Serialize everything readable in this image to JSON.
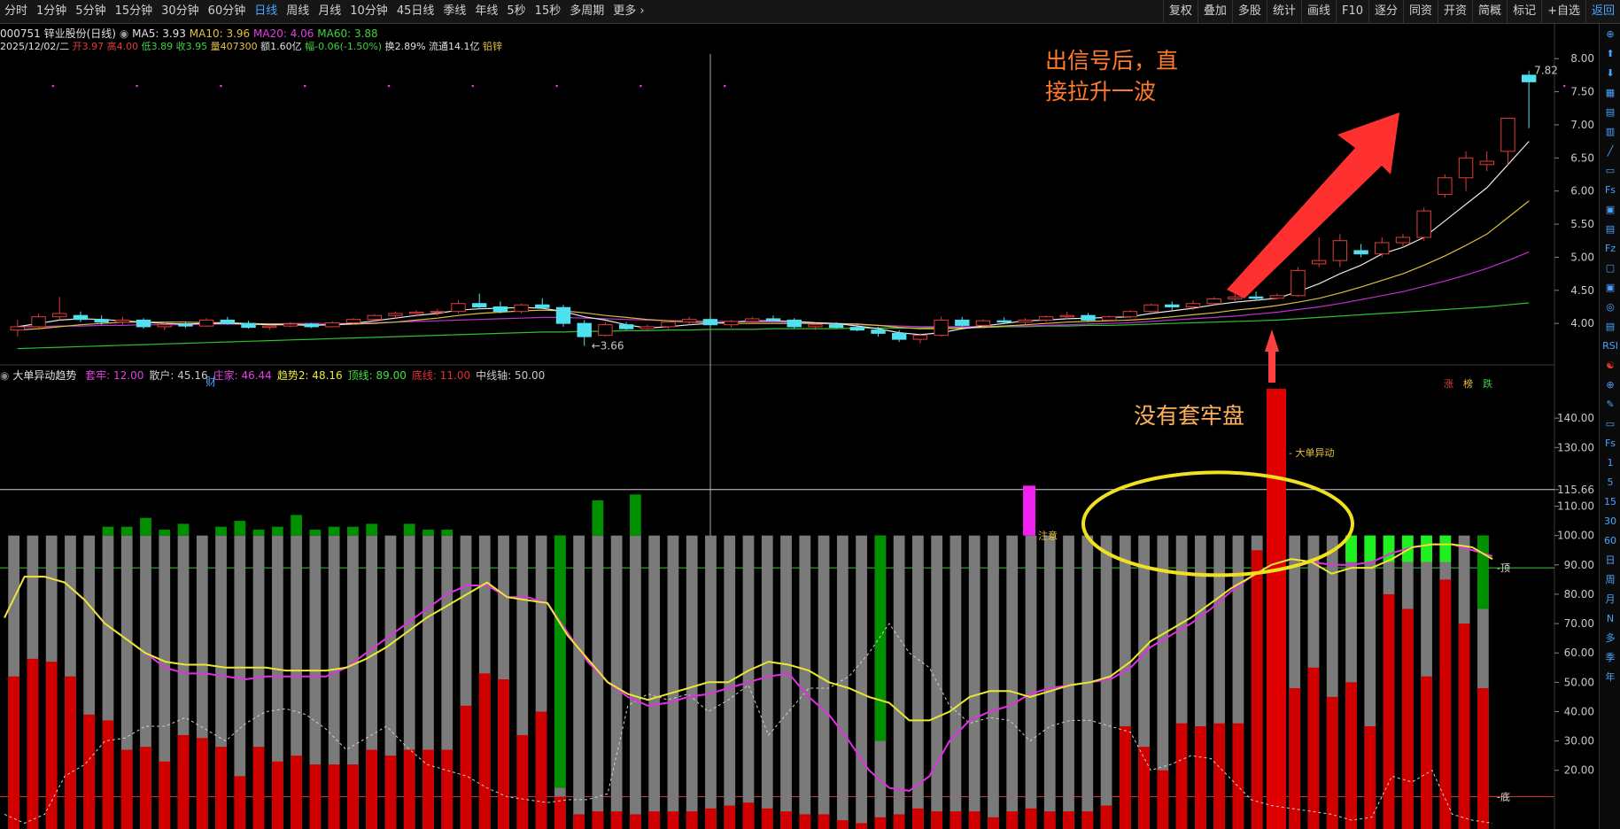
{
  "toolbar": {
    "left": [
      "分时",
      "1分钟",
      "5分钟",
      "15分钟",
      "30分钟",
      "60分钟",
      "日线",
      "周线",
      "月线",
      "10分钟",
      "45日线",
      "季线",
      "年线",
      "5秒",
      "15秒",
      "多周期",
      "更多 ›"
    ],
    "active_index": 6,
    "right": [
      "复权",
      "叠加",
      "多股",
      "统计",
      "画线",
      "F10",
      "逐分",
      "同资",
      "开资",
      "简概",
      "标记",
      "+自选",
      "返回"
    ],
    "right_highlight": [
      12
    ]
  },
  "header": {
    "code_name": "000751 锌业股份(日线)",
    "ma5": "MA5: 3.93",
    "ma10": "MA10: 3.96",
    "ma20": "MA20: 4.06",
    "ma60": "MA60: 3.88",
    "date": "2025/12/02/二",
    "open": "开3.97",
    "high": "高4.00",
    "low": "低3.89",
    "close": "收3.95",
    "vol": "量407300",
    "amount": "额1.60亿",
    "change": "幅-0.06(-1.50%)",
    "turnover": "换2.89%",
    "float": "流通14.1亿",
    "concept": "铅锌"
  },
  "annotations": {
    "top_line1": "出信号后，直",
    "top_line2": "接拉升一波",
    "bottom": "没有套牢盘"
  },
  "price_chart": {
    "y_ticks": [
      "8.00",
      "7.50",
      "7.00",
      "6.50",
      "6.00",
      "5.50",
      "5.00",
      "4.50",
      "4.00"
    ],
    "low_label": "3.66",
    "high_label": "7.82",
    "cai_label": "财",
    "bottom_tags": [
      "涨",
      "榜",
      "跌"
    ]
  },
  "indicator": {
    "title": "大单异动趋势",
    "vals": [
      {
        "label": "套牢: 12.00",
        "color": "#e040e0"
      },
      {
        "label": "散户: 45.16",
        "color": "#c8c8c8"
      },
      {
        "label": "庄家: 46.44",
        "color": "#e040e0"
      },
      {
        "label": "趋势2: 48.16",
        "color": "#e8e840"
      },
      {
        "label": "顶线: 89.00",
        "color": "#40e040"
      },
      {
        "label": "底线: 11.00",
        "color": "#e03030"
      },
      {
        "label": "中线轴: 50.00",
        "color": "#c8c8c8"
      }
    ],
    "y_ticks": [
      "140.00",
      "130.00",
      "115.66",
      "110.00",
      "100.00",
      "90.00",
      "80.00",
      "70.00",
      "60.00",
      "50.00",
      "40.00",
      "30.00",
      "20.00"
    ],
    "label_dadan": "大单异动",
    "label_zhuyi": "注意",
    "label_ding": "顶",
    "label_di": "底"
  },
  "sidebar": [
    "⊕",
    "⬆",
    "⬇",
    "▦",
    "▤",
    "▥",
    "╱",
    "▭",
    "Fs",
    "▣",
    "▤",
    "Fz",
    "▢",
    "▣",
    "◎",
    "▤",
    "RSI",
    "☯",
    "⊕",
    "✎",
    "▭",
    "Fs",
    "1",
    "5",
    "15",
    "30",
    "60",
    "日",
    "周",
    "月",
    "N",
    "多",
    "季",
    "年"
  ],
  "chart_data": {
    "type": "candlestick",
    "price": {
      "ylim": [
        3.4,
        8.15
      ],
      "candles_ohlc": [
        [
          3.9,
          4.05,
          3.8,
          3.95
        ],
        [
          3.95,
          4.15,
          3.9,
          4.1
        ],
        [
          4.1,
          4.4,
          4.05,
          4.15
        ],
        [
          4.12,
          4.18,
          4.02,
          4.06
        ],
        [
          4.06,
          4.12,
          3.98,
          4.02
        ],
        [
          4.02,
          4.1,
          3.98,
          4.05
        ],
        [
          4.05,
          4.08,
          3.92,
          3.95
        ],
        [
          3.95,
          4.02,
          3.9,
          3.98
        ],
        [
          3.98,
          4.03,
          3.93,
          3.96
        ],
        [
          3.96,
          4.08,
          3.95,
          4.05
        ],
        [
          4.05,
          4.1,
          3.98,
          4.0
        ],
        [
          4.0,
          4.04,
          3.92,
          3.94
        ],
        [
          3.94,
          3.98,
          3.9,
          3.96
        ],
        [
          3.96,
          4.02,
          3.94,
          3.99
        ],
        [
          3.99,
          4.01,
          3.93,
          3.95
        ],
        [
          3.95,
          4.03,
          3.94,
          4.01
        ],
        [
          4.01,
          4.08,
          3.99,
          4.06
        ],
        [
          4.06,
          4.14,
          4.04,
          4.12
        ],
        [
          4.12,
          4.18,
          4.08,
          4.15
        ],
        [
          4.15,
          4.2,
          4.1,
          4.17
        ],
        [
          4.17,
          4.22,
          4.12,
          4.18
        ],
        [
          4.18,
          4.35,
          4.15,
          4.3
        ],
        [
          4.3,
          4.45,
          4.22,
          4.25
        ],
        [
          4.25,
          4.33,
          4.15,
          4.18
        ],
        [
          4.18,
          4.3,
          4.15,
          4.28
        ],
        [
          4.28,
          4.38,
          4.22,
          4.24
        ],
        [
          4.24,
          4.28,
          3.95,
          4.0
        ],
        [
          4.0,
          4.05,
          3.66,
          3.8
        ],
        [
          3.82,
          4.02,
          3.8,
          3.98
        ],
        [
          3.98,
          4.02,
          3.9,
          3.92
        ],
        [
          3.92,
          3.98,
          3.88,
          3.95
        ],
        [
          3.95,
          4.05,
          3.92,
          4.02
        ],
        [
          4.02,
          4.1,
          3.98,
          4.06
        ],
        [
          4.06,
          4.1,
          3.95,
          3.98
        ],
        [
          3.98,
          4.05,
          3.94,
          4.03
        ],
        [
          4.03,
          4.1,
          4.0,
          4.07
        ],
        [
          4.07,
          4.12,
          4.03,
          4.05
        ],
        [
          4.05,
          4.08,
          3.92,
          3.95
        ],
        [
          3.95,
          4.0,
          3.9,
          3.98
        ],
        [
          3.98,
          4.02,
          3.92,
          3.94
        ],
        [
          3.94,
          3.98,
          3.88,
          3.9
        ],
        [
          3.9,
          3.95,
          3.8,
          3.85
        ],
        [
          3.85,
          3.9,
          3.72,
          3.76
        ],
        [
          3.76,
          3.85,
          3.7,
          3.82
        ],
        [
          3.82,
          4.1,
          3.8,
          4.05
        ],
        [
          4.05,
          4.1,
          3.95,
          3.97
        ],
        [
          3.97,
          4.06,
          3.95,
          4.04
        ],
        [
          4.04,
          4.09,
          4.0,
          4.02
        ],
        [
          4.02,
          4.08,
          3.98,
          4.05
        ],
        [
          4.05,
          4.12,
          4.02,
          4.1
        ],
        [
          4.1,
          4.18,
          4.06,
          4.12
        ],
        [
          4.12,
          4.16,
          4.02,
          4.05
        ],
        [
          4.05,
          4.12,
          4.03,
          4.1
        ],
        [
          4.1,
          4.2,
          4.08,
          4.18
        ],
        [
          4.18,
          4.3,
          4.15,
          4.28
        ],
        [
          4.28,
          4.33,
          4.2,
          4.25
        ],
        [
          4.25,
          4.35,
          4.2,
          4.3
        ],
        [
          4.3,
          4.4,
          4.28,
          4.37
        ],
        [
          4.37,
          4.45,
          4.32,
          4.4
        ],
        [
          4.4,
          4.48,
          4.36,
          4.38
        ],
        [
          4.38,
          4.45,
          4.36,
          4.42
        ],
        [
          4.42,
          4.85,
          4.4,
          4.8
        ],
        [
          4.9,
          5.3,
          4.85,
          4.95
        ],
        [
          4.95,
          5.35,
          4.85,
          5.25
        ],
        [
          5.1,
          5.2,
          5.0,
          5.05
        ],
        [
          5.05,
          5.3,
          5.0,
          5.22
        ],
        [
          5.22,
          5.35,
          5.15,
          5.3
        ],
        [
          5.3,
          5.75,
          5.25,
          5.7
        ],
        [
          5.95,
          6.25,
          5.9,
          6.2
        ],
        [
          6.2,
          6.6,
          6.0,
          6.5
        ],
        [
          6.4,
          6.6,
          6.3,
          6.45
        ],
        [
          6.6,
          7.1,
          6.4,
          7.1
        ],
        [
          7.75,
          7.82,
          6.95,
          7.65
        ]
      ],
      "ma5": [
        3.95,
        4.0,
        4.05,
        4.07,
        4.06,
        4.04,
        4.02,
        4.0,
        3.99,
        4.0,
        4.0,
        3.99,
        3.98,
        3.98,
        3.97,
        3.98,
        4.0,
        4.04,
        4.08,
        4.12,
        4.15,
        4.2,
        4.22,
        4.23,
        4.24,
        4.23,
        4.18,
        4.1,
        4.05,
        3.98,
        3.93,
        3.95,
        3.98,
        4.0,
        4.02,
        4.04,
        4.04,
        4.03,
        4.01,
        4.0,
        3.96,
        3.92,
        3.86,
        3.83,
        3.86,
        3.92,
        3.96,
        4.0,
        4.04,
        4.05,
        4.07,
        4.08,
        4.09,
        4.1,
        4.15,
        4.19,
        4.23,
        4.28,
        4.32,
        4.35,
        4.38,
        4.48,
        4.6,
        4.75,
        4.88,
        5.05,
        5.15,
        5.3,
        5.55,
        5.8,
        6.05,
        6.4,
        6.75
      ],
      "ma10": [
        3.9,
        3.92,
        3.95,
        3.98,
        4.0,
        4.02,
        4.02,
        4.02,
        4.02,
        4.01,
        4.01,
        4.0,
        3.99,
        3.99,
        3.98,
        3.98,
        3.99,
        4.0,
        4.02,
        4.05,
        4.08,
        4.12,
        4.15,
        4.17,
        4.19,
        4.2,
        4.19,
        4.16,
        4.12,
        4.09,
        4.06,
        4.04,
        4.02,
        4.01,
        4.0,
        4.0,
        4.0,
        4.0,
        4.0,
        4.0,
        3.99,
        3.97,
        3.94,
        3.92,
        3.92,
        3.93,
        3.94,
        3.96,
        3.98,
        4.0,
        4.02,
        4.03,
        4.04,
        4.05,
        4.07,
        4.1,
        4.13,
        4.16,
        4.2,
        4.23,
        4.27,
        4.32,
        4.38,
        4.46,
        4.55,
        4.65,
        4.75,
        4.88,
        5.02,
        5.18,
        5.35,
        5.6,
        5.85
      ],
      "ma20": [
        3.95,
        3.95,
        3.96,
        3.96,
        3.97,
        3.97,
        3.98,
        3.98,
        3.98,
        3.99,
        3.99,
        3.99,
        3.99,
        4.0,
        4.0,
        4.0,
        4.0,
        4.01,
        4.02,
        4.03,
        4.04,
        4.05,
        4.06,
        4.07,
        4.08,
        4.09,
        4.09,
        4.08,
        4.07,
        4.06,
        4.05,
        4.04,
        4.04,
        4.03,
        4.03,
        4.02,
        4.02,
        4.01,
        4.0,
        3.99,
        3.98,
        3.97,
        3.96,
        3.95,
        3.95,
        3.95,
        3.95,
        3.96,
        3.96,
        3.97,
        3.98,
        3.99,
        4.0,
        4.01,
        4.03,
        4.05,
        4.07,
        4.09,
        4.11,
        4.14,
        4.17,
        4.21,
        4.25,
        4.3,
        4.36,
        4.42,
        4.48,
        4.56,
        4.64,
        4.73,
        4.83,
        4.95,
        5.08
      ],
      "ma60": [
        3.62,
        3.63,
        3.64,
        3.65,
        3.66,
        3.67,
        3.68,
        3.69,
        3.7,
        3.71,
        3.72,
        3.73,
        3.74,
        3.75,
        3.76,
        3.77,
        3.78,
        3.79,
        3.8,
        3.81,
        3.82,
        3.83,
        3.84,
        3.85,
        3.86,
        3.87,
        3.87,
        3.88,
        3.88,
        3.89,
        3.89,
        3.9,
        3.9,
        3.91,
        3.91,
        3.91,
        3.92,
        3.92,
        3.92,
        3.92,
        3.93,
        3.93,
        3.93,
        3.93,
        3.94,
        3.94,
        3.94,
        3.95,
        3.95,
        3.96,
        3.96,
        3.97,
        3.97,
        3.98,
        3.99,
        4.0,
        4.01,
        4.02,
        4.03,
        4.04,
        4.05,
        4.07,
        4.09,
        4.11,
        4.13,
        4.15,
        4.17,
        4.19,
        4.21,
        4.23,
        4.25,
        4.28,
        4.31
      ]
    },
    "indicator": {
      "ylim": [
        0,
        150
      ],
      "top_line": 89,
      "bottom_line": 11,
      "total_bar": 100,
      "red_values": [
        52,
        58,
        57,
        52,
        39,
        37,
        27,
        28,
        23,
        32,
        31,
        28,
        18,
        28,
        23,
        25,
        22,
        22,
        22,
        27,
        25,
        27,
        27,
        27,
        42,
        53,
        51,
        32,
        40,
        11,
        5,
        6,
        6,
        5,
        6,
        6,
        6,
        7,
        8,
        9,
        7,
        6,
        5,
        5,
        3,
        2,
        4,
        5,
        7,
        6,
        6,
        6,
        4,
        6,
        7,
        6,
        6,
        6,
        8,
        35,
        28,
        20,
        36,
        35,
        36,
        36,
        95,
        72,
        48,
        55,
        45,
        50,
        35,
        80,
        75,
        52,
        85,
        70,
        48
      ],
      "green_values": [
        0,
        0,
        0,
        0,
        0,
        3,
        3,
        6,
        2,
        4,
        0,
        3,
        5,
        2,
        3,
        7,
        2,
        3,
        3,
        4,
        0,
        4,
        2,
        2,
        0,
        0,
        0,
        0,
        0,
        0,
        0,
        12,
        0,
        14,
        0,
        0,
        0,
        0,
        0,
        0,
        0,
        0,
        0,
        0,
        0,
        0,
        0,
        0,
        0,
        0,
        0,
        0,
        0,
        0,
        0,
        0,
        0,
        0,
        0,
        0,
        0,
        0,
        0,
        0,
        0,
        0,
        0,
        0,
        0,
        0,
        0,
        0,
        0,
        0,
        0,
        0,
        0,
        0,
        0
      ],
      "green_down_values": [
        0,
        0,
        0,
        0,
        0,
        0,
        0,
        0,
        0,
        0,
        0,
        0,
        0,
        0,
        0,
        0,
        0,
        0,
        0,
        0,
        0,
        0,
        0,
        0,
        0,
        0,
        0,
        0,
        0,
        86,
        0,
        0,
        0,
        0,
        0,
        0,
        0,
        0,
        0,
        0,
        0,
        0,
        0,
        0,
        0,
        0,
        70,
        0,
        0,
        0,
        0,
        0,
        0,
        0,
        0,
        0,
        0,
        0,
        0,
        0,
        0,
        0,
        0,
        0,
        0,
        0,
        0,
        0,
        0,
        0,
        0,
        0,
        0,
        0,
        0,
        0,
        0,
        0,
        25
      ],
      "trend_yellow": [
        72,
        86,
        86,
        84,
        78,
        70,
        65,
        60,
        57,
        56,
        56,
        55,
        55,
        55,
        54,
        54,
        54,
        55,
        58,
        62,
        67,
        72,
        76,
        80,
        84,
        79,
        78,
        77,
        66,
        58,
        50,
        46,
        44,
        46,
        48,
        50,
        50,
        54,
        57,
        56,
        54,
        50,
        48,
        45,
        43,
        37,
        37,
        40,
        45,
        47,
        47,
        45,
        47,
        49,
        50,
        52,
        57,
        64,
        68,
        72,
        77,
        82,
        86,
        90,
        92,
        91,
        87,
        89,
        89,
        92,
        96,
        97,
        97,
        96,
        92
      ],
      "zhuangjia_magenta": [
        72,
        86,
        86,
        84,
        78,
        70,
        65,
        60,
        55,
        53,
        53,
        52,
        51,
        52,
        52,
        52,
        52,
        55,
        60,
        65,
        70,
        75,
        80,
        83,
        83,
        79,
        79,
        77,
        67,
        57,
        50,
        45,
        42,
        43,
        45,
        46,
        48,
        50,
        52,
        53,
        45,
        39,
        30,
        20,
        14,
        13,
        18,
        30,
        37,
        40,
        42,
        46,
        48,
        49,
        50,
        51,
        55,
        62,
        66,
        70,
        75,
        81,
        86,
        90,
        92,
        91,
        90,
        90,
        91,
        94,
        96,
        97,
        97,
        95,
        93
      ],
      "sanhu_dashed": [
        5,
        2,
        5,
        18,
        22,
        30,
        31,
        35,
        35,
        38,
        34,
        30,
        36,
        40,
        41,
        39,
        34,
        27,
        31,
        35,
        28,
        22,
        20,
        18,
        14,
        11,
        10,
        9,
        10,
        10,
        12,
        42,
        46,
        44,
        46,
        40,
        44,
        49,
        32,
        40,
        48,
        48,
        52,
        60,
        70,
        60,
        55,
        42,
        36,
        38,
        37,
        30,
        35,
        37,
        37,
        35,
        33,
        20,
        22,
        25,
        24,
        17,
        10,
        8,
        7,
        6,
        5,
        3,
        4,
        18,
        16,
        20,
        5,
        3,
        2
      ]
    }
  }
}
